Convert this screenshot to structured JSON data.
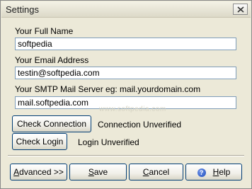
{
  "window": {
    "title": "Settings"
  },
  "form": {
    "full_name": {
      "label": "Your Full Name",
      "value": "softpedia"
    },
    "email": {
      "label": "Your Email Address",
      "value": "testin@softpedia.com"
    },
    "smtp": {
      "label": "Your SMTP Mail Server eg: mail.yourdomain.com",
      "value": "mail.softpedia.com"
    }
  },
  "checks": {
    "connection": {
      "button": "Check Connection",
      "status": "Connection Unverified"
    },
    "login": {
      "button": "Check Login",
      "status": "Login Unverified"
    }
  },
  "watermark": "www.softpedia.com",
  "footer": {
    "advanced": {
      "accel": "A",
      "rest": "dvanced >>"
    },
    "save": {
      "accel": "S",
      "rest": "ave"
    },
    "cancel": {
      "accel": "C",
      "rest": "ancel"
    },
    "help": {
      "accel": "H",
      "rest": "elp",
      "icon_glyph": "?"
    }
  }
}
